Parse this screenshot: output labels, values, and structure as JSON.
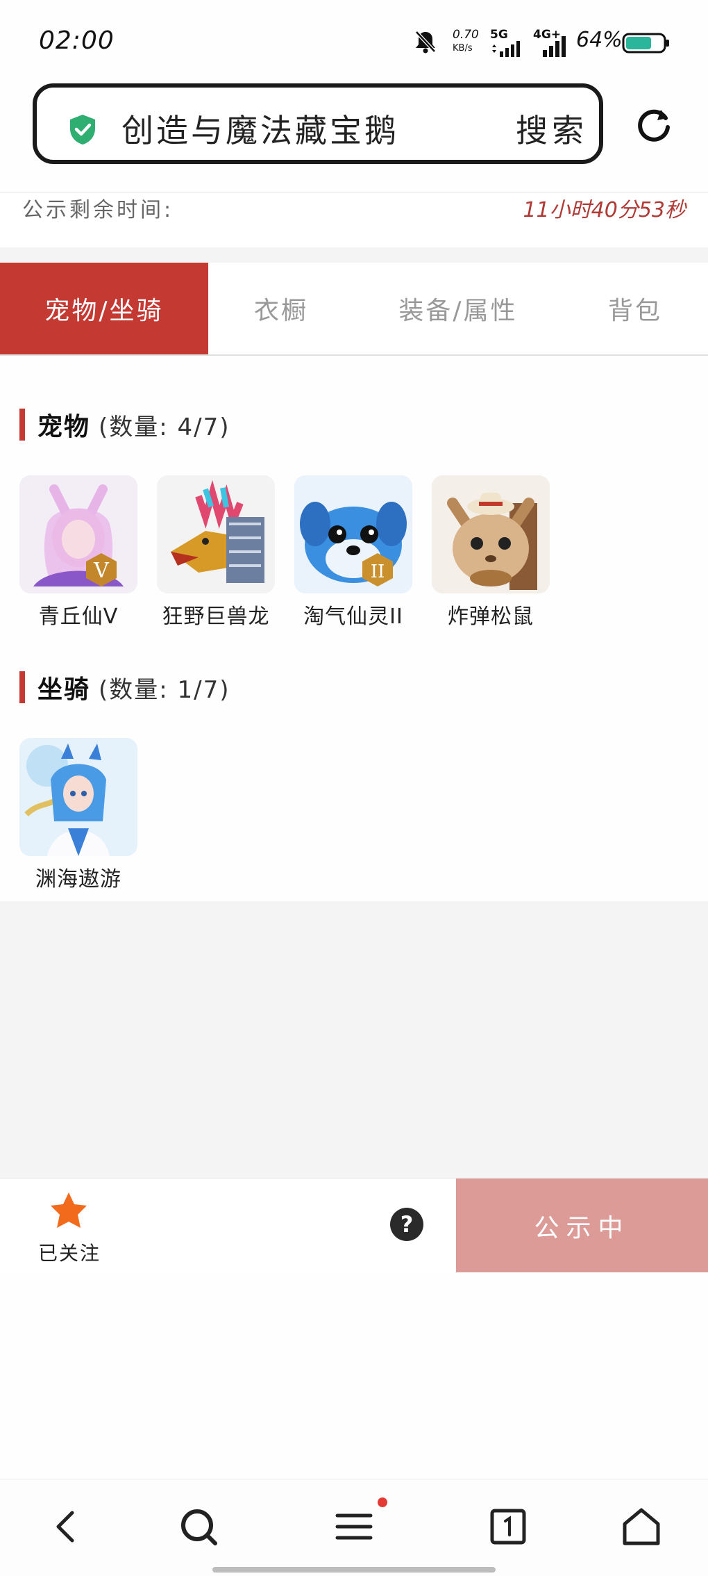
{
  "status_bar": {
    "time": "02:00",
    "net_speed_value": "0.70",
    "net_speed_unit": "KB/s",
    "sim1": "5G",
    "sim2": "4G+",
    "battery": "64%"
  },
  "search": {
    "query": "创造与魔法藏宝鹅",
    "button_label": "搜索"
  },
  "countdown": {
    "label": "公示剩余时间:",
    "value": "11小时40分53秒"
  },
  "tabs": [
    {
      "label": "宠物/坐骑",
      "active": true
    },
    {
      "label": "衣橱",
      "active": false
    },
    {
      "label": "装备/属性",
      "active": false
    },
    {
      "label": "背包",
      "active": false
    }
  ],
  "pets": {
    "title": "宠物",
    "count": "(数量: 4/7)",
    "items": [
      {
        "name": "青丘仙V",
        "icon": "fox-fairy-portrait"
      },
      {
        "name": "狂野巨兽龙",
        "icon": "wild-dragon-portrait"
      },
      {
        "name": "淘气仙灵II",
        "icon": "blue-puppy-portrait"
      },
      {
        "name": "炸弹松鼠",
        "icon": "bomb-squirrel-portrait"
      }
    ]
  },
  "mounts": {
    "title": "坐骑",
    "count": "(数量: 1/7)",
    "items": [
      {
        "name": "渊海遨游",
        "icon": "sea-wanderer-portrait"
      }
    ]
  },
  "actions": {
    "favorite_label": "已关注",
    "help_label": "?",
    "publish_label": "公示中"
  },
  "colors": {
    "accent": "#c53933",
    "publish_button": "#dc9b97",
    "countdown_text": "#b03a35",
    "star": "#f26b1d"
  }
}
